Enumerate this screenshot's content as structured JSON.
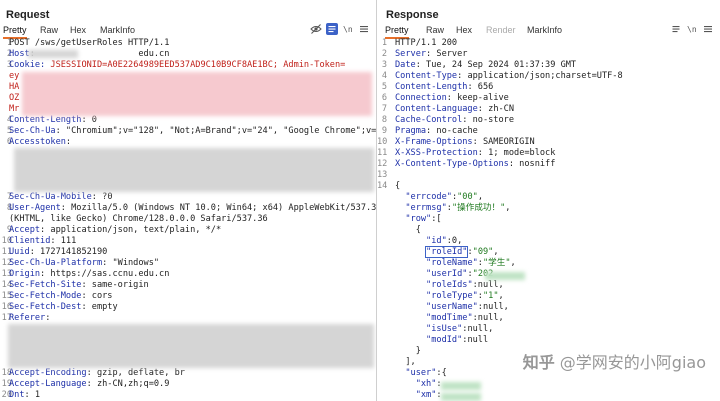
{
  "request": {
    "title": "Request",
    "tabs": [
      "Pretty",
      "Raw",
      "Hex",
      "MarkInfo"
    ],
    "active_tab": "Pretty",
    "lines": [
      {
        "n": "1",
        "segs": [
          [
            "hv",
            "POST /sws/getUserRoles HTTP/1.1"
          ]
        ]
      },
      {
        "n": "2",
        "segs": [
          [
            "hk",
            "Host"
          ],
          [
            "hv",
            ": "
          ],
          [
            "hv",
            "                   edu.cn"
          ]
        ]
      },
      {
        "n": "3",
        "segs": [
          [
            "hk",
            "Cookie: "
          ],
          [
            "red",
            "JSESSIONID=A0E2264989EED537AD9C10B9CF8AE1BC; Admin-Token="
          ]
        ]
      },
      {
        "n": "",
        "segs": [
          [
            "red",
            "ey"
          ]
        ]
      },
      {
        "n": "",
        "segs": [
          [
            "red",
            "HA"
          ]
        ]
      },
      {
        "n": "",
        "segs": [
          [
            "red",
            "OZ"
          ]
        ]
      },
      {
        "n": "",
        "segs": [
          [
            "red",
            "Mr"
          ]
        ]
      },
      {
        "n": "4",
        "segs": [
          [
            "hk",
            "Content-Length"
          ],
          [
            "hv",
            ": 0"
          ]
        ]
      },
      {
        "n": "5",
        "segs": [
          [
            "hk",
            "Sec-Ch-Ua"
          ],
          [
            "hv",
            ": \"Chromium\";v=\"128\", \"Not;A=Brand\";v=\"24\", \"Google Chrome\";v=\"128\""
          ]
        ]
      },
      {
        "n": "6",
        "segs": [
          [
            "hk",
            "Accesstoken"
          ],
          [
            "hv",
            ":"
          ]
        ]
      },
      {
        "n": "",
        "segs": []
      },
      {
        "n": "",
        "segs": []
      },
      {
        "n": "",
        "segs": []
      },
      {
        "n": "",
        "segs": []
      },
      {
        "n": "7",
        "segs": [
          [
            "hk",
            "Sec-Ch-Ua-Mobile"
          ],
          [
            "hv",
            ": ?0"
          ]
        ]
      },
      {
        "n": "8",
        "segs": [
          [
            "hk",
            "User-Agent"
          ],
          [
            "hv",
            ": Mozilla/5.0 (Windows NT 10.0; Win64; x64) AppleWebKit/537.36"
          ]
        ]
      },
      {
        "n": "",
        "segs": [
          [
            "hv",
            "(KHTML, like Gecko) Chrome/128.0.0.0 Safari/537.36"
          ]
        ]
      },
      {
        "n": "9",
        "segs": [
          [
            "hk",
            "Accept"
          ],
          [
            "hv",
            ": application/json, text/plain, */*"
          ]
        ]
      },
      {
        "n": "10",
        "segs": [
          [
            "hk",
            "Clientid"
          ],
          [
            "hv",
            ": 111"
          ]
        ]
      },
      {
        "n": "11",
        "segs": [
          [
            "hk",
            "Uuid"
          ],
          [
            "hv",
            ": 1727141852190"
          ]
        ]
      },
      {
        "n": "12",
        "segs": [
          [
            "hk",
            "Sec-Ch-Ua-Platform"
          ],
          [
            "hv",
            ": \"Windows\""
          ]
        ]
      },
      {
        "n": "13",
        "segs": [
          [
            "hk",
            "Origin"
          ],
          [
            "hv",
            ": https://sas.ccnu.edu.cn"
          ]
        ]
      },
      {
        "n": "14",
        "segs": [
          [
            "hk",
            "Sec-Fetch-Site"
          ],
          [
            "hv",
            ": same-origin"
          ]
        ]
      },
      {
        "n": "15",
        "segs": [
          [
            "hk",
            "Sec-Fetch-Mode"
          ],
          [
            "hv",
            ": cors"
          ]
        ]
      },
      {
        "n": "16",
        "segs": [
          [
            "hk",
            "Sec-Fetch-Dest"
          ],
          [
            "hv",
            ": empty"
          ]
        ]
      },
      {
        "n": "17",
        "segs": [
          [
            "hk",
            "Referer"
          ],
          [
            "hv",
            ":"
          ]
        ]
      },
      {
        "n": "",
        "segs": []
      },
      {
        "n": "",
        "segs": []
      },
      {
        "n": "",
        "segs": []
      },
      {
        "n": "",
        "segs": []
      },
      {
        "n": "18",
        "segs": [
          [
            "hk",
            "Accept-Encoding"
          ],
          [
            "hv",
            ": gzip, deflate, br"
          ]
        ]
      },
      {
        "n": "19",
        "segs": [
          [
            "hk",
            "Accept-Language"
          ],
          [
            "hv",
            ": zh-CN,zh;q=0.9"
          ]
        ]
      },
      {
        "n": "20",
        "segs": [
          [
            "hk",
            "Dnt"
          ],
          [
            "hv",
            ": 1"
          ]
        ]
      }
    ]
  },
  "response": {
    "title": "Response",
    "tabs": [
      "Pretty",
      "Raw",
      "Hex",
      "Render",
      "MarkInfo"
    ],
    "active_tab": "Pretty",
    "disabled_tab": "Render",
    "lines": [
      {
        "n": "1",
        "segs": [
          [
            "hv",
            "HTTP/1.1 200"
          ]
        ]
      },
      {
        "n": "2",
        "segs": [
          [
            "hk",
            "Server"
          ],
          [
            "hv",
            ": Server"
          ]
        ]
      },
      {
        "n": "3",
        "segs": [
          [
            "hk",
            "Date"
          ],
          [
            "hv",
            ": Tue, 24 Sep 2024 01:37:39 GMT"
          ]
        ]
      },
      {
        "n": "4",
        "segs": [
          [
            "hk",
            "Content-Type"
          ],
          [
            "hv",
            ": application/json;charset=UTF-8"
          ]
        ]
      },
      {
        "n": "5",
        "segs": [
          [
            "hk",
            "Content-Length"
          ],
          [
            "hv",
            ": 656"
          ]
        ]
      },
      {
        "n": "6",
        "segs": [
          [
            "hk",
            "Connection"
          ],
          [
            "hv",
            ": keep-alive"
          ]
        ]
      },
      {
        "n": "7",
        "segs": [
          [
            "hk",
            "Content-Language"
          ],
          [
            "hv",
            ": zh-CN"
          ]
        ]
      },
      {
        "n": "8",
        "segs": [
          [
            "hk",
            "Cache-Control"
          ],
          [
            "hv",
            ": no-store"
          ]
        ]
      },
      {
        "n": "9",
        "segs": [
          [
            "hk",
            "Pragma"
          ],
          [
            "hv",
            ": no-cache"
          ]
        ]
      },
      {
        "n": "10",
        "segs": [
          [
            "hk",
            "X-Frame-Options"
          ],
          [
            "hv",
            ": SAMEORIGIN"
          ]
        ]
      },
      {
        "n": "11",
        "segs": [
          [
            "hk",
            "X-XSS-Protection"
          ],
          [
            "hv",
            ": 1; mode=block"
          ]
        ]
      },
      {
        "n": "12",
        "segs": [
          [
            "hk",
            "X-Content-Type-Options"
          ],
          [
            "hv",
            ": nosniff"
          ]
        ]
      },
      {
        "n": "13",
        "segs": []
      },
      {
        "n": "14",
        "segs": [
          [
            "js-p",
            "{"
          ]
        ]
      },
      {
        "n": "",
        "segs": [
          [
            "js-p",
            "  "
          ],
          [
            "js-k",
            "\"errcode\""
          ],
          [
            "js-p",
            ":"
          ],
          [
            "js-s",
            "\"00\""
          ],
          [
            "js-p",
            ","
          ]
        ]
      },
      {
        "n": "",
        "segs": [
          [
            "js-p",
            "  "
          ],
          [
            "js-k",
            "\"errmsg\""
          ],
          [
            "js-p",
            ":"
          ],
          [
            "js-s",
            "\"操作成功！\""
          ],
          [
            "js-p",
            ","
          ]
        ]
      },
      {
        "n": "",
        "segs": [
          [
            "js-p",
            "  "
          ],
          [
            "js-k",
            "\"row\""
          ],
          [
            "js-p",
            ":["
          ]
        ]
      },
      {
        "n": "",
        "segs": [
          [
            "js-p",
            "    {"
          ]
        ]
      },
      {
        "n": "",
        "segs": [
          [
            "js-p",
            "      "
          ],
          [
            "js-k",
            "\"id\""
          ],
          [
            "js-p",
            ":0,"
          ]
        ]
      },
      {
        "n": "",
        "segs": [
          [
            "js-p",
            "      "
          ],
          [
            "js-k",
            "\"roleId\""
          ],
          [
            "js-p",
            ":"
          ],
          [
            "js-s",
            "\"09\""
          ],
          [
            "js-p",
            ","
          ]
        ],
        "hl": true
      },
      {
        "n": "",
        "segs": [
          [
            "js-p",
            "      "
          ],
          [
            "js-k",
            "\"roleName\""
          ],
          [
            "js-p",
            ":"
          ],
          [
            "js-s",
            "\"学生\""
          ],
          [
            "js-p",
            ","
          ]
        ]
      },
      {
        "n": "",
        "segs": [
          [
            "js-p",
            "      "
          ],
          [
            "js-k",
            "\"userId\""
          ],
          [
            "js-p",
            ":"
          ],
          [
            "js-s",
            "\"202"
          ]
        ]
      },
      {
        "n": "",
        "segs": [
          [
            "js-p",
            "      "
          ],
          [
            "js-k",
            "\"roleIds\""
          ],
          [
            "js-p",
            ":null,"
          ]
        ]
      },
      {
        "n": "",
        "segs": [
          [
            "js-p",
            "      "
          ],
          [
            "js-k",
            "\"roleType\""
          ],
          [
            "js-p",
            ":"
          ],
          [
            "js-s",
            "\"1\""
          ],
          [
            "js-p",
            ","
          ]
        ]
      },
      {
        "n": "",
        "segs": [
          [
            "js-p",
            "      "
          ],
          [
            "js-k",
            "\"userName\""
          ],
          [
            "js-p",
            ":null,"
          ]
        ]
      },
      {
        "n": "",
        "segs": [
          [
            "js-p",
            "      "
          ],
          [
            "js-k",
            "\"modTime\""
          ],
          [
            "js-p",
            ":null,"
          ]
        ]
      },
      {
        "n": "",
        "segs": [
          [
            "js-p",
            "      "
          ],
          [
            "js-k",
            "\"isUse\""
          ],
          [
            "js-p",
            ":null,"
          ]
        ]
      },
      {
        "n": "",
        "segs": [
          [
            "js-p",
            "      "
          ],
          [
            "js-k",
            "\"modId\""
          ],
          [
            "js-p",
            ":null"
          ]
        ]
      },
      {
        "n": "",
        "segs": [
          [
            "js-p",
            "    }"
          ]
        ]
      },
      {
        "n": "",
        "segs": [
          [
            "js-p",
            "  ],"
          ]
        ]
      },
      {
        "n": "",
        "segs": [
          [
            "js-p",
            "  "
          ],
          [
            "js-k",
            "\"user\""
          ],
          [
            "js-p",
            ":{"
          ]
        ]
      },
      {
        "n": "",
        "segs": [
          [
            "js-p",
            "    "
          ],
          [
            "js-k",
            "\"xh\""
          ],
          [
            "js-p",
            ":"
          ]
        ]
      },
      {
        "n": "",
        "segs": [
          [
            "js-p",
            "    "
          ],
          [
            "js-k",
            "\"xm\""
          ],
          [
            "js-p",
            ":"
          ]
        ]
      }
    ]
  },
  "watermark": {
    "site": "知乎",
    "author": "@学网安的小阿giao"
  },
  "icons": {
    "req_tools": [
      "eye-off-icon",
      "wrap-icon",
      "newline-icon",
      "menu-icon"
    ],
    "res_tools": [
      "wrap-icon",
      "newline-icon",
      "menu-icon"
    ]
  }
}
